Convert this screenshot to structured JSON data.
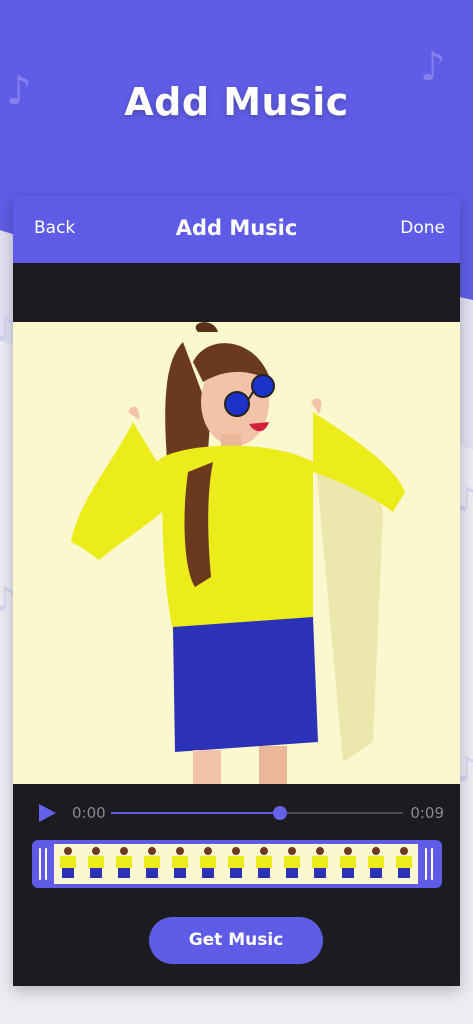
{
  "hero": {
    "title": "Add Music",
    "music_note_icon": "music-note-icon"
  },
  "topbar": {
    "back_label": "Back",
    "title": "Add Music",
    "done_label": "Done"
  },
  "player": {
    "play_icon": "play-icon",
    "current_time": "0:00",
    "total_time": "0:09",
    "progress": 0.58
  },
  "actions": {
    "get_music_label": "Get Music"
  },
  "colors": {
    "brand_purple": "#5f5de6",
    "dark_panel": "#1c1b1f",
    "photo_background": "#fbf8cf",
    "sweater_yellow": "#ecec1a",
    "skirt_blue": "#2b32b8"
  }
}
